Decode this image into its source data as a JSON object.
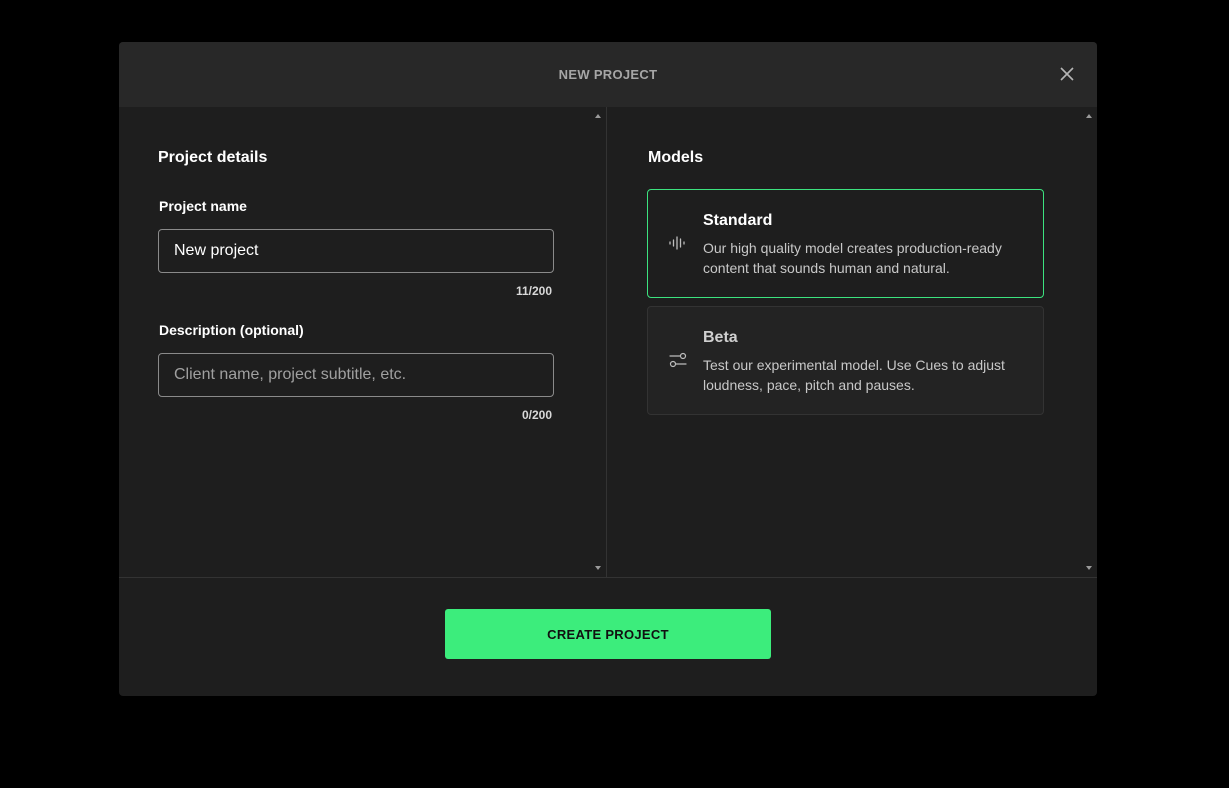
{
  "modal": {
    "title": "NEW PROJECT",
    "close_icon": "close-icon"
  },
  "project_details": {
    "heading": "Project details",
    "name_label": "Project name",
    "name_value": "New project",
    "name_counter": "11/200",
    "description_label": "Description (optional)",
    "description_value": "",
    "description_placeholder": "Client name, project subtitle, etc.",
    "description_counter": "0/200"
  },
  "models": {
    "heading": "Models",
    "items": [
      {
        "name": "Standard",
        "description": "Our high quality model creates production-ready content that sounds human and natural.",
        "icon": "waveform-icon",
        "selected": true
      },
      {
        "name": "Beta",
        "description": "Test our experimental model. Use Cues to adjust loudness, pace, pitch and pauses.",
        "icon": "sliders-icon",
        "selected": false
      }
    ]
  },
  "footer": {
    "create_label": "CREATE PROJECT"
  },
  "colors": {
    "accent": "#3ced7c",
    "background": "#1e1e1e",
    "header": "#282828"
  }
}
